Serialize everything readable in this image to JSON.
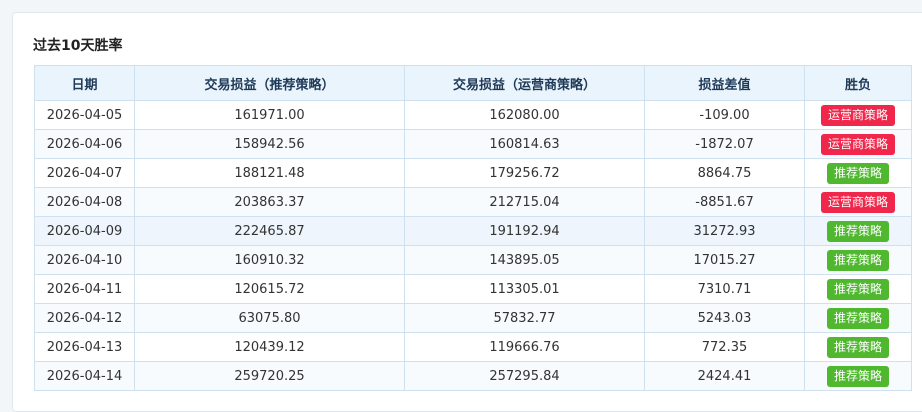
{
  "section": {
    "title": "过去10天胜率"
  },
  "table": {
    "columns": [
      "日期",
      "交易损益（推荐策略）",
      "交易损益（运营商策略）",
      "损益差值",
      "胜负"
    ],
    "rows": [
      {
        "date": "2026-04-05",
        "rec_pnl": "161971.00",
        "op_pnl": "162080.00",
        "diff": "-109.00",
        "winner": "运营商策略",
        "winner_type": "op"
      },
      {
        "date": "2026-04-06",
        "rec_pnl": "158942.56",
        "op_pnl": "160814.63",
        "diff": "-1872.07",
        "winner": "运营商策略",
        "winner_type": "op"
      },
      {
        "date": "2026-04-07",
        "rec_pnl": "188121.48",
        "op_pnl": "179256.72",
        "diff": "8864.75",
        "winner": "推荐策略",
        "winner_type": "rec"
      },
      {
        "date": "2026-04-08",
        "rec_pnl": "203863.37",
        "op_pnl": "212715.04",
        "diff": "-8851.67",
        "winner": "运营商策略",
        "winner_type": "op"
      },
      {
        "date": "2026-04-09",
        "rec_pnl": "222465.87",
        "op_pnl": "191192.94",
        "diff": "31272.93",
        "winner": "推荐策略",
        "winner_type": "rec"
      },
      {
        "date": "2026-04-10",
        "rec_pnl": "160910.32",
        "op_pnl": "143895.05",
        "diff": "17015.27",
        "winner": "推荐策略",
        "winner_type": "rec"
      },
      {
        "date": "2026-04-11",
        "rec_pnl": "120615.72",
        "op_pnl": "113305.01",
        "diff": "7310.71",
        "winner": "推荐策略",
        "winner_type": "rec"
      },
      {
        "date": "2026-04-12",
        "rec_pnl": "63075.80",
        "op_pnl": "57832.77",
        "diff": "5243.03",
        "winner": "推荐策略",
        "winner_type": "rec"
      },
      {
        "date": "2026-04-13",
        "rec_pnl": "120439.12",
        "op_pnl": "119666.76",
        "diff": "772.35",
        "winner": "推荐策略",
        "winner_type": "rec"
      },
      {
        "date": "2026-04-14",
        "rec_pnl": "259720.25",
        "op_pnl": "257295.84",
        "diff": "2424.41",
        "winner": "推荐策略",
        "winner_type": "rec"
      }
    ],
    "highlighted_row": 4
  },
  "colors": {
    "operator_badge": "#f0264a",
    "recommended_badge": "#4fb82f",
    "header_bg": "#eaf4fc",
    "border": "#cfe0ee"
  }
}
